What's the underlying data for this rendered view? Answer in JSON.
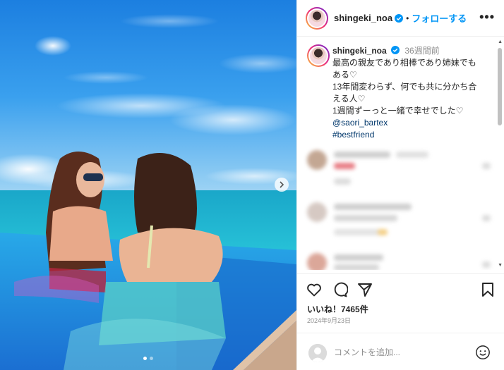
{
  "post": {
    "username": "shingeki_noa",
    "follow_label": "フォローする",
    "separator": "•",
    "more_label": "•••",
    "time_ago": "36週間前",
    "caption_lines": [
      "最高の親友であり相棒であり姉妹でも",
      "ある♡",
      "13年間変わらず、何でも共に分かち合",
      "える人♡",
      "1週間ずーっと一緒で幸せでした♡"
    ],
    "mention": "@saori_bartex",
    "hashtag": "#bestfriend",
    "likes": "いいね！7465件",
    "date": "2024年9月23日",
    "comment_placeholder": "コメントを追加...",
    "carousel": {
      "count": 2,
      "active": 1
    }
  },
  "icons": {
    "like": "heart-icon",
    "comment": "comment-icon",
    "share": "share-icon",
    "save": "bookmark-icon",
    "emoji": "emoji-icon",
    "verified": "verified-badge-icon",
    "next": "chevron-right-icon"
  },
  "colors": {
    "accent": "#0095f6",
    "link": "#00376b",
    "muted": "#8e8e8e"
  }
}
